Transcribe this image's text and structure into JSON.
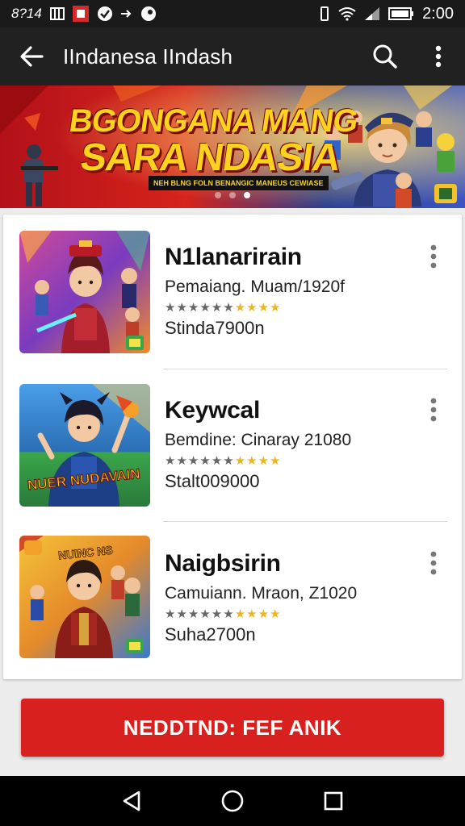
{
  "status_bar": {
    "time": "2:00",
    "left_text": "8?14",
    "icons": [
      "gallery-icon",
      "app-notification-icon",
      "check-circle-icon",
      "send-icon",
      "steam-icon",
      "vibrate-icon",
      "wifi-icon",
      "signal-icon",
      "battery-icon"
    ]
  },
  "app_bar": {
    "title": "IIndanesa IIndash",
    "icons": [
      "back-arrow-icon",
      "search-icon",
      "more-vert-icon"
    ]
  },
  "banner": {
    "line1": "BGONGANA MANG",
    "line2": "SARA NDASIA",
    "tagline": "NEH BLNG FOLN BENANGIC MANEUS CEWIASE",
    "page_count": 3,
    "active_page": 3,
    "colors": {
      "red": "#c8141c",
      "blue": "#2f46a8",
      "yellow": "#ffd21f"
    }
  },
  "games": [
    {
      "name": "N1lanarirain",
      "meta": "Pemaiang. Muam/1920f",
      "sub": "Stinda7900n",
      "rating": 4,
      "thumb_bg": "#7a3bbf",
      "thumb_accent": "#c0302a"
    },
    {
      "name": "Keywcal",
      "meta": "Bemdine: Cinaray 21080",
      "sub": "Stalt009000",
      "rating": 4,
      "thumb_bg": "#2b6fb5",
      "thumb_accent": "#1d3f86",
      "thumb_text": "NUER NUDAVAIN"
    },
    {
      "name": "Naigbsirin",
      "meta": "Camuiann. Mraon, Z1020",
      "sub": "Suha2700n",
      "rating": 4,
      "thumb_bg": "#e58a2a",
      "thumb_accent": "#a3271e",
      "thumb_text": "NUINC NS"
    }
  ],
  "cta": {
    "label": "NEDDTND: FEF ANIK",
    "color": "#d8201e"
  },
  "nav_bar": {
    "icons": [
      "back-triangle-icon",
      "home-circle-icon",
      "recents-square-icon"
    ]
  }
}
